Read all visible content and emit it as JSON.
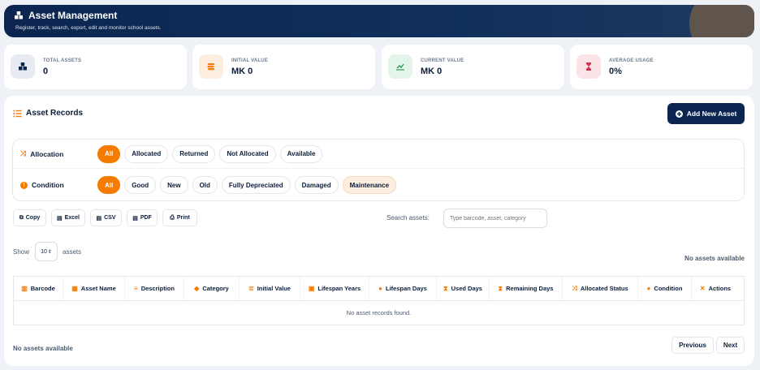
{
  "header": {
    "title": "Asset Management",
    "subtitle": "Register, track, search, export, edit and monitor school assets."
  },
  "stats": [
    {
      "label": "TOTAL ASSETS",
      "value": "0",
      "icon": "boxes-icon",
      "color": "#6b7a90"
    },
    {
      "label": "INITIAL VALUE",
      "value": "MK 0",
      "icon": "coins-icon",
      "color": "#f57c00"
    },
    {
      "label": "CURRENT VALUE",
      "value": "MK 0",
      "icon": "chart-line-icon",
      "color": "#2e9d5b"
    },
    {
      "label": "AVERAGE USAGE",
      "value": "0%",
      "icon": "hourglass-icon",
      "color": "#d9304f"
    }
  ],
  "records": {
    "title": "Asset Records",
    "add_button": "Add New Asset"
  },
  "filters": {
    "allocation": {
      "label": "Allocation",
      "options": [
        "All",
        "Allocated",
        "Returned",
        "Not Allocated",
        "Available"
      ]
    },
    "condition": {
      "label": "Condition",
      "options": [
        "All",
        "Good",
        "New",
        "Old",
        "Fully Depreciated",
        "Damaged",
        "Maintenance"
      ]
    }
  },
  "exports": [
    "Copy",
    "Excel",
    "CSV",
    "PDF",
    "Print"
  ],
  "search": {
    "label": "Search assets:",
    "placeholder": "Type barcode, asset, category"
  },
  "length": {
    "prefix": "Show",
    "value": "10",
    "suffix": "assets"
  },
  "info_top": "No assets available",
  "table": {
    "columns": [
      "Barcode",
      "Asset Name",
      "Description",
      "Category",
      "Initial Value",
      "Lifespan Years",
      "Lifespan Days",
      "Used Days",
      "Remaining Days",
      "Allocated Status",
      "Condition",
      "Actions"
    ],
    "empty": "No asset records found."
  },
  "info_bottom": "No assets available",
  "pagination": {
    "previous": "Previous",
    "next": "Next"
  },
  "colors": {
    "accent": "#f57c00",
    "navy": "#0b2550"
  }
}
